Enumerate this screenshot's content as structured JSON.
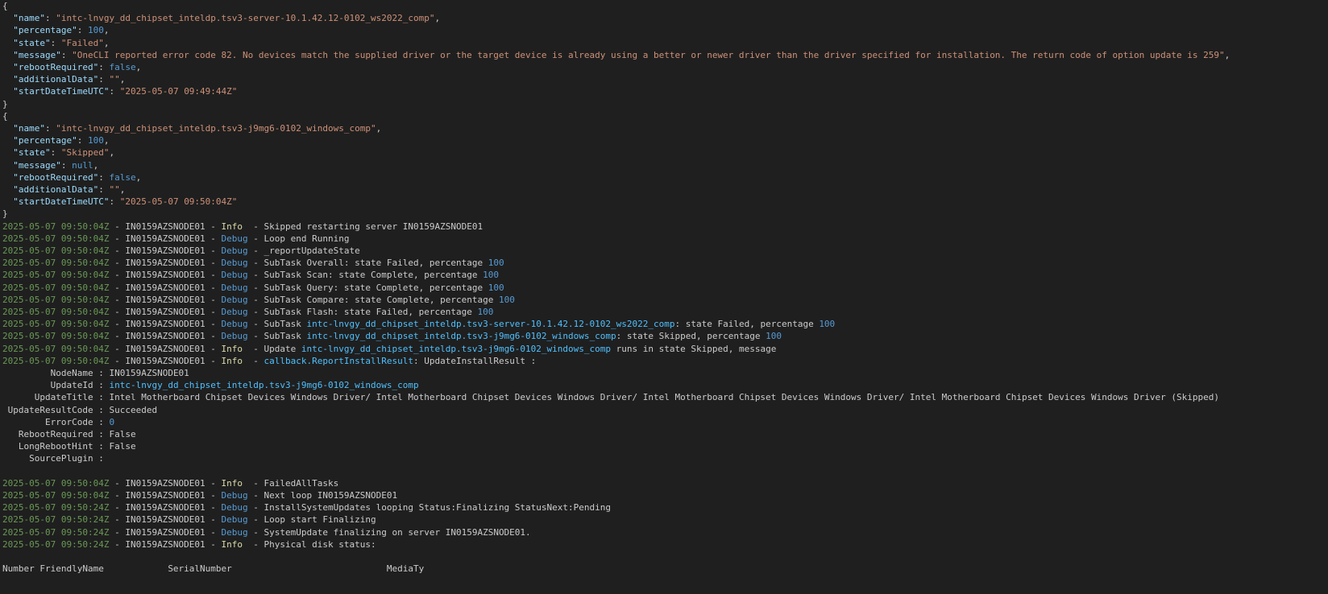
{
  "colors": {
    "background": "#1f1f1f",
    "text": "#cccccc",
    "json_key": "#9cdcfe",
    "json_string": "#ce9178",
    "json_literal": "#569cd6",
    "timestamp": "#6a9955",
    "info_level": "#dcdcaa",
    "debug_level": "#569cd6",
    "identifier": "#4fc1ff"
  },
  "json_blocks": [
    {
      "open": "{",
      "fields": [
        {
          "key": "\"name\"",
          "value": "\"intc-lnvgy_dd_chipset_inteldp.tsv3-server-10.1.42.12-0102_ws2022_comp\"",
          "kind": "s"
        },
        {
          "key": "\"percentage\"",
          "value": "100",
          "kind": "n"
        },
        {
          "key": "\"state\"",
          "value": "\"Failed\"",
          "kind": "s"
        },
        {
          "key": "\"message\"",
          "value": "\"OneCLI reported error code 82. No devices match the supplied driver or the target device is already using a better or newer driver than the driver specified for installation. The return code of option update is 259\"",
          "kind": "s"
        },
        {
          "key": "\"rebootRequired\"",
          "value": "false",
          "kind": "n"
        },
        {
          "key": "\"additionalData\"",
          "value": "\"\"",
          "kind": "s"
        },
        {
          "key": "\"startDateTimeUTC\"",
          "value": "\"2025-05-07 09:49:44Z\"",
          "kind": "s",
          "last": true
        }
      ],
      "close": "}"
    },
    {
      "open": "{",
      "fields": [
        {
          "key": "\"name\"",
          "value": "\"intc-lnvgy_dd_chipset_inteldp.tsv3-j9mg6-0102_windows_comp\"",
          "kind": "s"
        },
        {
          "key": "\"percentage\"",
          "value": "100",
          "kind": "n"
        },
        {
          "key": "\"state\"",
          "value": "\"Skipped\"",
          "kind": "s"
        },
        {
          "key": "\"message\"",
          "value": "null",
          "kind": "n"
        },
        {
          "key": "\"rebootRequired\"",
          "value": "false",
          "kind": "n"
        },
        {
          "key": "\"additionalData\"",
          "value": "\"\"",
          "kind": "s"
        },
        {
          "key": "\"startDateTimeUTC\"",
          "value": "\"2025-05-07 09:50:04Z\"",
          "kind": "s",
          "last": true
        }
      ],
      "close": "}"
    }
  ],
  "log_lines_a": [
    {
      "ts": "2025-05-07 09:50:04Z",
      "node": "IN0159AZSNODE01",
      "level": "Info",
      "parts": [
        {
          "t": "Skipped restarting server IN0159AZSNODE01"
        }
      ]
    },
    {
      "ts": "2025-05-07 09:50:04Z",
      "node": "IN0159AZSNODE01",
      "level": "Debug",
      "parts": [
        {
          "t": "Loop end Running"
        }
      ]
    },
    {
      "ts": "2025-05-07 09:50:04Z",
      "node": "IN0159AZSNODE01",
      "level": "Debug",
      "parts": [
        {
          "t": "_reportUpdateState"
        }
      ]
    },
    {
      "ts": "2025-05-07 09:50:04Z",
      "node": "IN0159AZSNODE01",
      "level": "Debug",
      "parts": [
        {
          "t": "SubTask Overall: state Failed, percentage "
        },
        {
          "t": "100",
          "c": "n"
        }
      ]
    },
    {
      "ts": "2025-05-07 09:50:04Z",
      "node": "IN0159AZSNODE01",
      "level": "Debug",
      "parts": [
        {
          "t": "SubTask Scan: state Complete, percentage "
        },
        {
          "t": "100",
          "c": "n"
        }
      ]
    },
    {
      "ts": "2025-05-07 09:50:04Z",
      "node": "IN0159AZSNODE01",
      "level": "Debug",
      "parts": [
        {
          "t": "SubTask Query: state Complete, percentage "
        },
        {
          "t": "100",
          "c": "n"
        }
      ]
    },
    {
      "ts": "2025-05-07 09:50:04Z",
      "node": "IN0159AZSNODE01",
      "level": "Debug",
      "parts": [
        {
          "t": "SubTask Compare: state Complete, percentage "
        },
        {
          "t": "100",
          "c": "n"
        }
      ]
    },
    {
      "ts": "2025-05-07 09:50:04Z",
      "node": "IN0159AZSNODE01",
      "level": "Debug",
      "parts": [
        {
          "t": "SubTask Flash: state Failed, percentage "
        },
        {
          "t": "100",
          "c": "n"
        }
      ]
    },
    {
      "ts": "2025-05-07 09:50:04Z",
      "node": "IN0159AZSNODE01",
      "level": "Debug",
      "parts": [
        {
          "t": "SubTask "
        },
        {
          "t": "intc-lnvgy_dd_chipset_inteldp.tsv3-server-10.1.42.12-0102_ws2022_comp",
          "c": "id"
        },
        {
          "t": ": state Failed, percentage "
        },
        {
          "t": "100",
          "c": "n"
        }
      ]
    },
    {
      "ts": "2025-05-07 09:50:04Z",
      "node": "IN0159AZSNODE01",
      "level": "Debug",
      "parts": [
        {
          "t": "SubTask "
        },
        {
          "t": "intc-lnvgy_dd_chipset_inteldp.tsv3-j9mg6-0102_windows_comp",
          "c": "id"
        },
        {
          "t": ": state Skipped, percentage "
        },
        {
          "t": "100",
          "c": "n"
        }
      ]
    },
    {
      "ts": "2025-05-07 09:50:04Z",
      "node": "IN0159AZSNODE01",
      "level": "Info",
      "parts": [
        {
          "t": "Update "
        },
        {
          "t": "intc-lnvgy_dd_chipset_inteldp.tsv3-j9mg6-0102_windows_comp",
          "c": "id"
        },
        {
          "t": " runs in state Skipped, message"
        }
      ]
    },
    {
      "ts": "2025-05-07 09:50:04Z",
      "node": "IN0159AZSNODE01",
      "level": "Info",
      "parts": [
        {
          "t": "callback.ReportInstallResult",
          "c": "id"
        },
        {
          "t": ": UpdateInstallResult :"
        }
      ]
    }
  ],
  "result_props": [
    {
      "key": "NodeName",
      "value": "IN0159AZSNODE01",
      "c": ""
    },
    {
      "key": "UpdateId",
      "value": "intc-lnvgy_dd_chipset_inteldp.tsv3-j9mg6-0102_windows_comp",
      "c": "id"
    },
    {
      "key": "UpdateTitle",
      "value": "Intel Motherboard Chipset Devices Windows Driver/ Intel Motherboard Chipset Devices Windows Driver/ Intel Motherboard Chipset Devices Windows Driver/ Intel Motherboard Chipset Devices Windows Driver (Skipped)",
      "c": ""
    },
    {
      "key": "UpdateResultCode",
      "value": "Succeeded",
      "c": ""
    },
    {
      "key": "ErrorCode",
      "value": "0",
      "c": "n"
    },
    {
      "key": "RebootRequired",
      "value": "False",
      "c": ""
    },
    {
      "key": "LongRebootHint",
      "value": "False",
      "c": ""
    },
    {
      "key": "SourcePlugin",
      "value": "",
      "c": ""
    }
  ],
  "log_lines_b": [
    {
      "ts": "2025-05-07 09:50:04Z",
      "node": "IN0159AZSNODE01",
      "level": "Info",
      "parts": [
        {
          "t": "FailedAllTasks"
        }
      ]
    },
    {
      "ts": "2025-05-07 09:50:04Z",
      "node": "IN0159AZSNODE01",
      "level": "Debug",
      "parts": [
        {
          "t": "Next loop IN0159AZSNODE01"
        }
      ]
    },
    {
      "ts": "2025-05-07 09:50:24Z",
      "node": "IN0159AZSNODE01",
      "level": "Debug",
      "parts": [
        {
          "t": "InstallSystemUpdates looping Status:Finalizing StatusNext:Pending"
        }
      ]
    },
    {
      "ts": "2025-05-07 09:50:24Z",
      "node": "IN0159AZSNODE01",
      "level": "Debug",
      "parts": [
        {
          "t": "Loop start Finalizing"
        }
      ]
    },
    {
      "ts": "2025-05-07 09:50:24Z",
      "node": "IN0159AZSNODE01",
      "level": "Debug",
      "parts": [
        {
          "t": "SystemUpdate finalizing on server IN0159AZSNODE01."
        }
      ]
    },
    {
      "ts": "2025-05-07 09:50:24Z",
      "node": "IN0159AZSNODE01",
      "level": "Info",
      "parts": [
        {
          "t": "Physical disk status:"
        }
      ]
    }
  ],
  "table_header": {
    "columns": [
      "Number",
      "FriendlyName",
      "SerialNumber",
      "MediaTy"
    ]
  }
}
